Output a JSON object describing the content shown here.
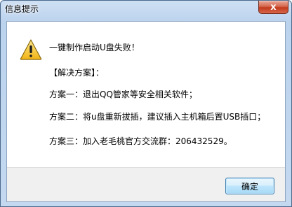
{
  "window": {
    "title": "信息提示",
    "close_glyph": "x"
  },
  "message": {
    "lines": [
      "一键制作启动U盘失败！",
      "【解决方案】：",
      "方案一：退出QQ管家等安全相关软件；",
      "方案二：将u盘重新拔插，建议插入主机箱后置USB插口；",
      "方案三：加入老毛桃官方交流群：206432529。"
    ]
  },
  "buttons": {
    "ok_label": "确定"
  },
  "icons": {
    "warning": "warning-icon"
  },
  "colors": {
    "warning_fill": "#f7c22c",
    "warning_border": "#8a6a10",
    "close_red": "#c2391c"
  }
}
